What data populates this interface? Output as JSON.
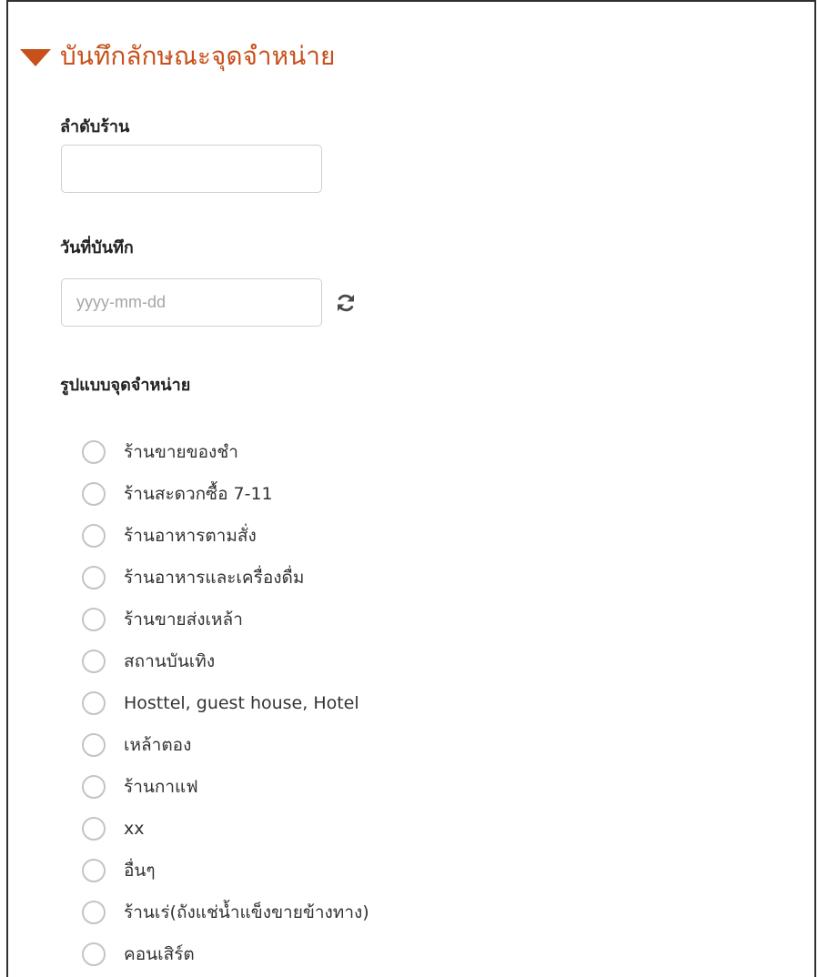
{
  "section": {
    "title": "บันทึกลักษณะจุดจำหน่าย"
  },
  "fields": {
    "store_order": {
      "label": "ลำดับร้าน",
      "value": ""
    },
    "record_date": {
      "label": "วันที่บันทึก",
      "placeholder": "yyyy-mm-dd",
      "value": ""
    },
    "outlet_type": {
      "label": "รูปแบบจุดจำหน่าย",
      "selected": null,
      "options": [
        "ร้านขายของชำ",
        "ร้านสะดวกซื้อ 7-11",
        "ร้านอาหารตามสั่ง",
        "ร้านอาหารและเครื่องดื่ม",
        "ร้านขายส่งเหล้า",
        "สถานบันเทิง",
        "Hosttel, guest house, Hotel",
        "เหล้าตอง",
        "ร้านกาแฟ",
        "xx",
        "อื่นๆ",
        "ร้านเร่(ถังแช่น้ำแข็งขายข้างทาง)",
        "คอนเสิร์ต"
      ]
    }
  },
  "icons": {
    "section_toggle": "caret-down-icon",
    "date_refresh": "refresh-icon",
    "option_radio": "radio-empty-icon"
  },
  "colors": {
    "accent": "#c8501a",
    "label": "#222222",
    "input_border": "#cfcfcf",
    "radio_border": "#c4c4c4",
    "placeholder": "#a6a6a6"
  }
}
